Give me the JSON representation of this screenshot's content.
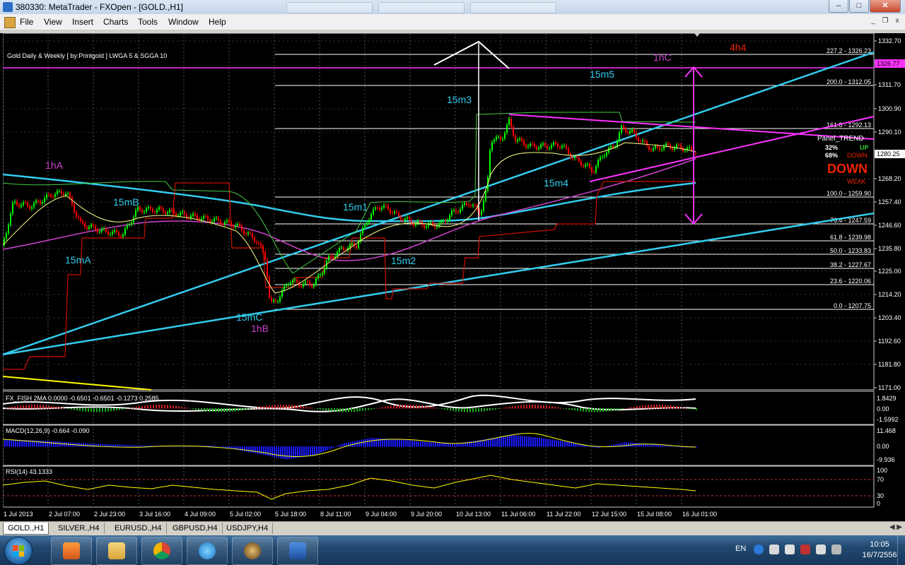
{
  "window": {
    "title": "380330: MetaTrader - FXOpen - [GOLD.,H1]",
    "minimize": "–",
    "maximize": "□",
    "close": "✕"
  },
  "menu": [
    "File",
    "View",
    "Insert",
    "Charts",
    "Tools",
    "Window",
    "Help"
  ],
  "mdi": {
    "minimize": "_",
    "restore": "❐",
    "close": "x"
  },
  "chart": {
    "header": "Gold Daily & Weekly [ by:Printgold ]  LWGA 5  &  SGGA 10",
    "price_labels": [
      "1332.70",
      "1311.70",
      "1300.90",
      "1290.10",
      "1268.20",
      "1257.40",
      "1246.60",
      "1235.80",
      "1225.00",
      "1214.20",
      "1203.40",
      "1192.60",
      "1181.80",
      "1171.00"
    ],
    "price_current": "1280.25",
    "price_magenta": "1326.77",
    "time_labels": [
      "1 Jul 2013",
      "2 Jul 07:00",
      "2 Jul 23:00",
      "3 Jul 16:00",
      "4 Jul 09:00",
      "5 Jul 02:00",
      "5 Jul 18:00",
      "8 Jul 11:00",
      "9 Jul 04:00",
      "9 Jul 20:00",
      "10 Jul 13:00",
      "11 Jul 06:00",
      "11 Jul 22:00",
      "12 Jul 15:00",
      "15 Jul 08:00",
      "16 Jul 01:00"
    ],
    "fib_levels": [
      "227.2 - 1326.23",
      "200.0 - 1312.05",
      "161.8 - 1292.13",
      "100.0 - 1259.90",
      "76.4 - 1247.59",
      "61.8 - 1239.98",
      "50.0 - 1233.83",
      "38.2 - 1227.67",
      "23.6 - 1220.06",
      "0.0 - 1207.75"
    ],
    "annotations": {
      "a_1hA": "1hA",
      "a_15mB": "15mB",
      "a_15mA": "15mA",
      "a_15mC": "15mC",
      "a_1hB": "1hB",
      "a_15m1": "15m1",
      "a_15m2": "15m2",
      "a_15m3": "15m3",
      "a_15m4": "15m4",
      "a_15m5": "15m5",
      "a_1hC": "1hC",
      "a_4h4": "4h4"
    },
    "panel": {
      "title": "Panel_TREND",
      "pct_up": "32%",
      "up": "UP",
      "pct_down": "68%",
      "down": "DOWN",
      "big": "DOWN",
      "weak": "WEAK"
    },
    "fish": {
      "label": "FX_FISH  2MA 0.0000 -0.6501 -0.6501 -0.1273 0.2585",
      "scale": [
        "1.8429",
        "0.00",
        "-1.5992"
      ]
    },
    "macd": {
      "label": "MACD(12,26,9) -0.664 -0.090",
      "scale": [
        "11.468",
        "0.00",
        "-9.936"
      ]
    },
    "rsi": {
      "label": "RSI(14) 43.1333",
      "scale": [
        "100",
        "70",
        "30",
        "0"
      ]
    }
  },
  "tabs": [
    "GOLD.,H1",
    "SILVER.,H4",
    "EURUSD.,H4",
    "GBPUSD,H4",
    "USDJPY,H4"
  ],
  "taskbar": {
    "lang": "EN",
    "time": "10:05",
    "date": "16/7/2556",
    "apps": [
      "media-player",
      "file-explorer",
      "chrome",
      "internet-explorer",
      "metatrader",
      "word"
    ]
  },
  "colors": {
    "bull": "#00ff00",
    "bear": "#ff0000",
    "cyan": "#33ccee",
    "magenta": "#ff33ff",
    "fib": "#ffffff",
    "price_bg": "#000000"
  }
}
